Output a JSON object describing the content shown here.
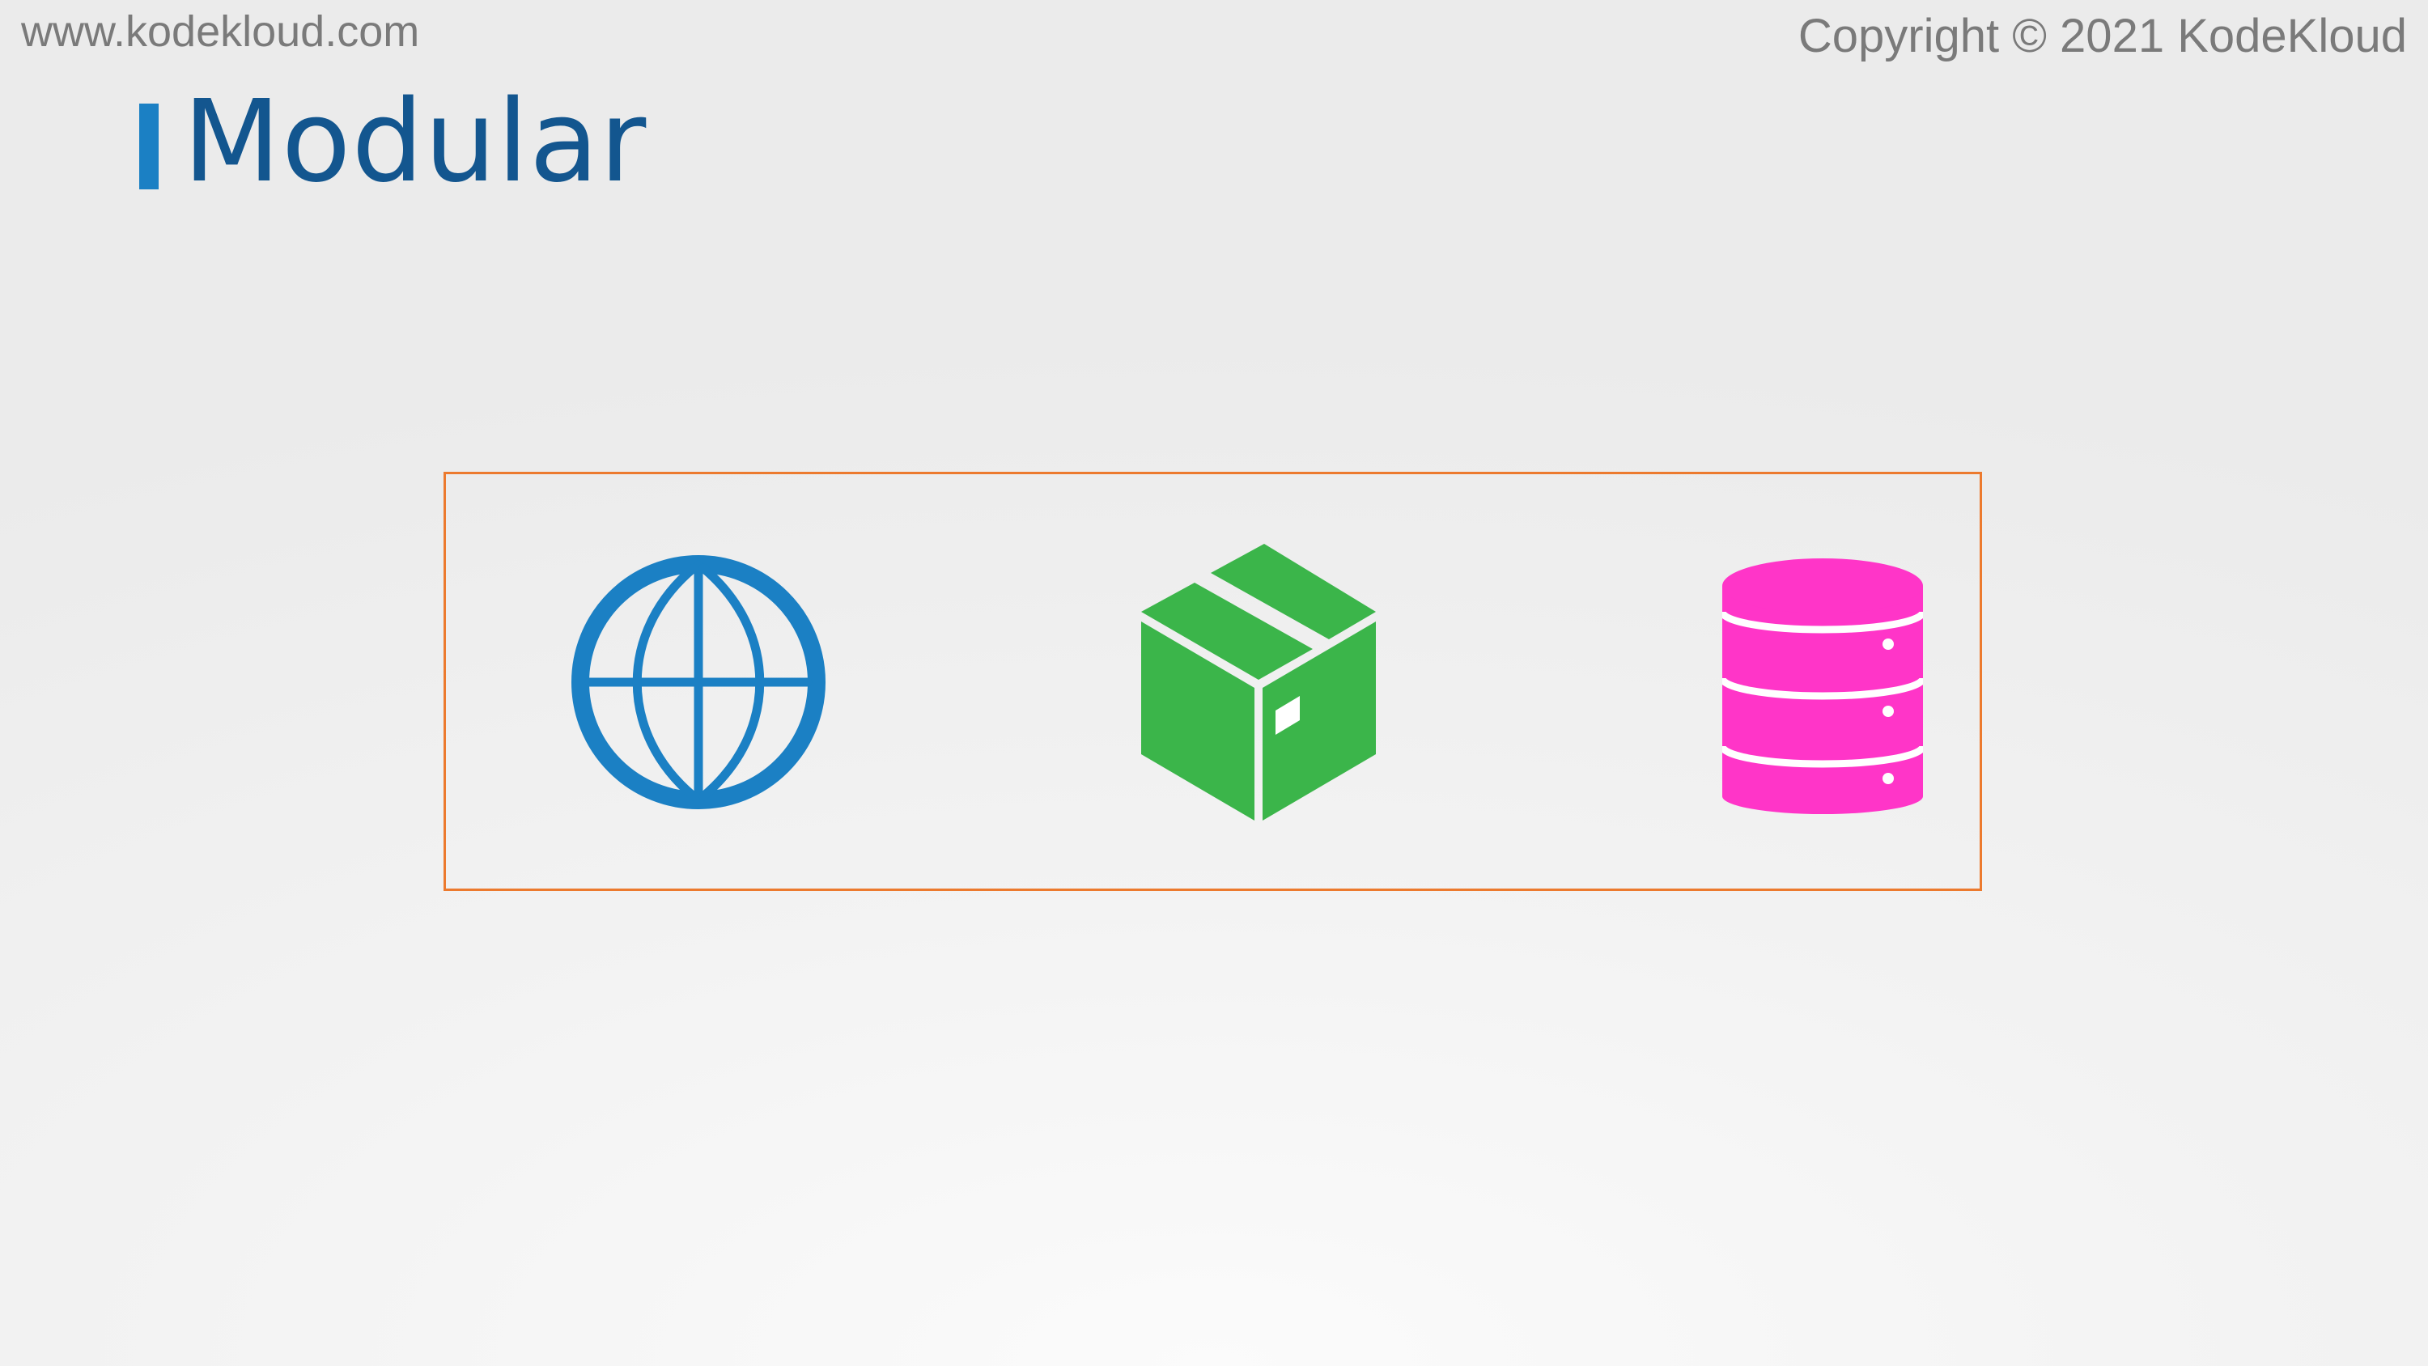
{
  "header": {
    "site_url": "www.kodekloud.com",
    "copyright": "Copyright © 2021 KodeKloud"
  },
  "slide": {
    "title": "Modular",
    "modules": [
      {
        "icon": "globe-icon",
        "color": "#1b80c4"
      },
      {
        "icon": "package-icon",
        "color": "#3bb54a"
      },
      {
        "icon": "database-icon",
        "color": "#ff35c8"
      }
    ]
  },
  "colors": {
    "title": "#13568f",
    "title_accent": "#1b80c4",
    "frame_border": "#ec7a2e",
    "header_text": "#7a7a7a"
  }
}
